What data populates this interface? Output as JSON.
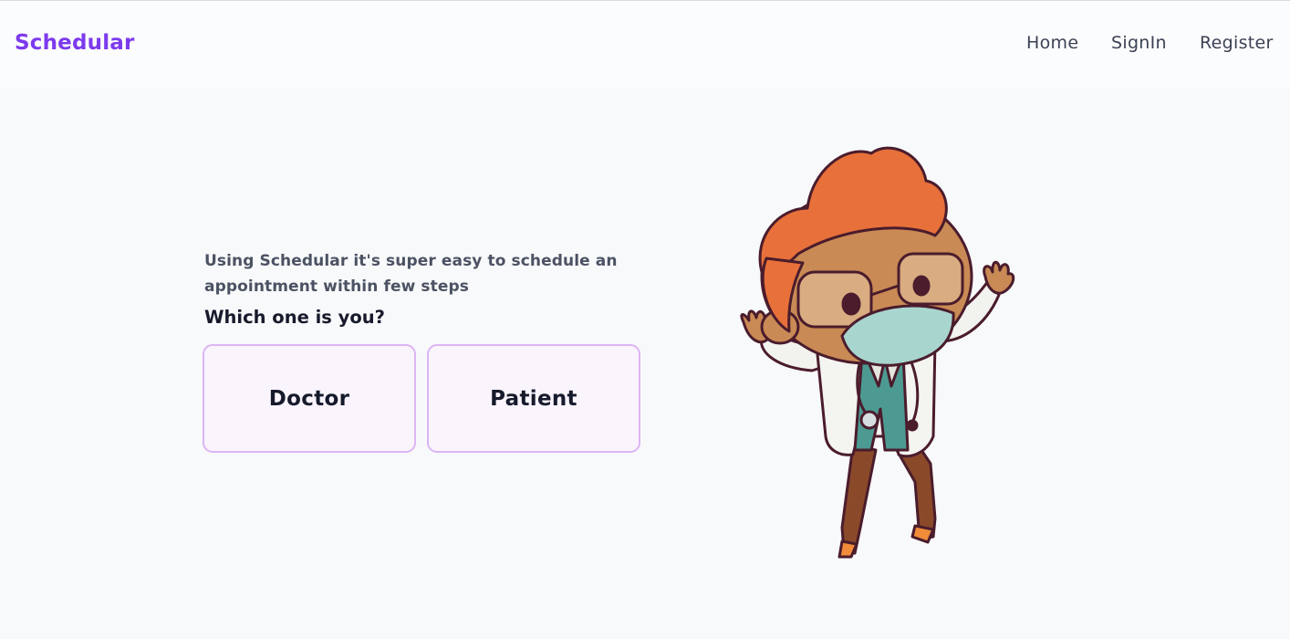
{
  "nav": {
    "brand": "Schedular",
    "links": [
      "Home",
      "SignIn",
      "Register"
    ]
  },
  "hero": {
    "intro_text": "Using Schedular it's super easy to schedule an appointment within few steps",
    "question": "Which one is you?",
    "options": [
      "Doctor",
      "Patient"
    ]
  },
  "colors": {
    "brand": "#7c3aed",
    "card_border": "#dcb5f4",
    "card_bg": "#faf4fd",
    "page_bg": "#f8f9fa"
  },
  "icons": {
    "illustration": "doctor-character-illustration"
  }
}
